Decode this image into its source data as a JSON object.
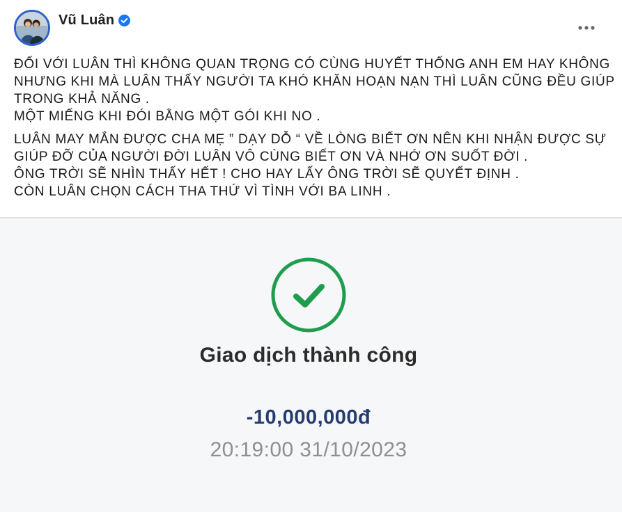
{
  "post": {
    "author_name": "Vũ Luân",
    "verified": true,
    "avatar_icon": "profile-photo",
    "more_icon": "more-options-icon",
    "paragraphs": [
      {
        "lines": [
          "ĐỐI VỚI LUÂN THÌ KHÔNG QUAN TRỌNG CÓ CÙNG HUYẾT THỐNG ANH EM HAY KHÔNG",
          "NHƯNG KHI MÀ LUÂN THẤY NGƯỜI TA KHÓ KHĂN HOẠN NẠN THÌ LUÂN CŨNG ĐỀU GIÚP",
          "TRONG KHẢ NĂNG .",
          "MỘT MIẾNG KHI ĐÓI BẰNG MỘT GÓI KHI NO ."
        ]
      },
      {
        "lines": [
          "LUÂN MAY MẮN ĐƯỢC CHA MẸ ” DẠY DỖ “ VỀ LÒNG BIẾT ƠN NÊN KHI NHẬN ĐƯỢC SỰ",
          "GIÚP ĐỠ CỦA NGƯỜI ĐỜI LUÂN VÔ CÙNG BIẾT ƠN VÀ NHỚ ƠN SUỐT ĐỜI .",
          "ÔNG TRỜI SẼ NHÌN THẤY HẾT ! CHO HAY LẤY ÔNG TRỜI SẼ QUYẾT ĐỊNH .",
          "CÒN LUÂN CHỌN CÁCH THA THỨ VÌ TÌNH VỚI BA LINH ."
        ]
      }
    ]
  },
  "receipt": {
    "status_icon": "check-circle-icon",
    "status": "Giao dịch thành công",
    "amount": "-10,000,000đ",
    "datetime": "20:19:00 31/10/2023"
  },
  "colors": {
    "verified_blue": "#1877f2",
    "success_green": "#1f9d4c",
    "amount_navy": "#253c70",
    "datetime_gray": "#8d8f93",
    "receipt_bg": "#f6f7f9"
  }
}
